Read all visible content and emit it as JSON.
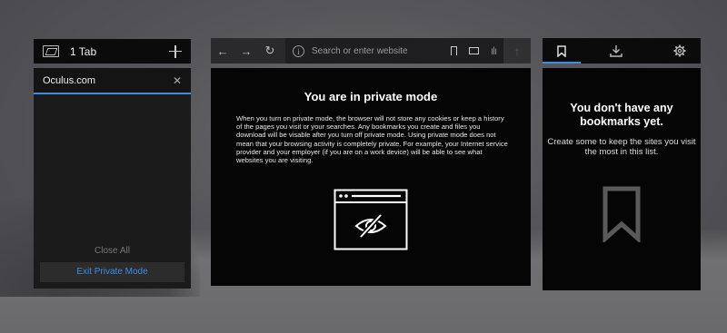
{
  "tabs_panel": {
    "count_label": "1 Tab",
    "tab": {
      "title": "Oculus.com"
    },
    "close_all": "Close All",
    "exit_private": "Exit Private Mode"
  },
  "browser": {
    "url_placeholder": "Search or enter website",
    "private_title": "You are in private mode",
    "private_text": "When you turn on private mode, the browser will not store any cookies or keep a history of the pages you visit or your searches. Any bookmarks you create and files you download will be visable after you turn off private mode. Using private mode does not mean that your browsing activity is completely private. For example, your Internet service provider and your employer (if you are on a work device) will be able to see what websites you are visiting."
  },
  "bookmarks_panel": {
    "title": "You don't have any bookmarks yet.",
    "subtitle": "Create some to keep the sites you visit the most in this list."
  },
  "colors": {
    "accent": "#3b8de6",
    "panel_bg": "#050505",
    "toolbar_bg": "#2a2a2c"
  }
}
